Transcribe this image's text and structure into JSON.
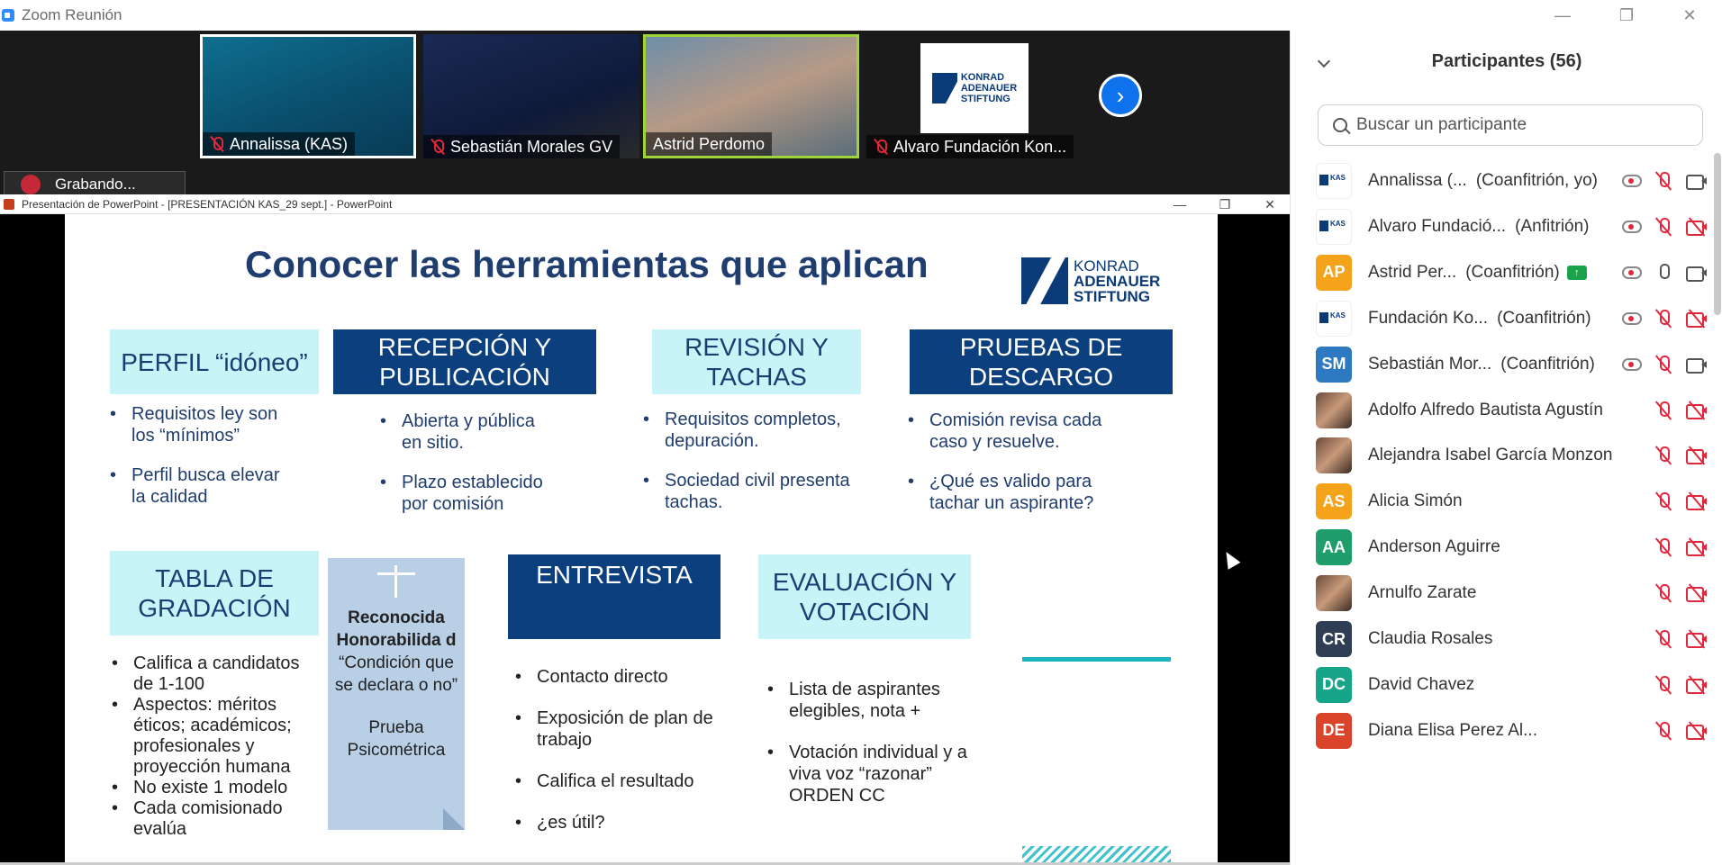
{
  "window": {
    "title": "Zoom Reunión"
  },
  "videos": [
    {
      "name": "Annalissa (KAS)",
      "muted": true
    },
    {
      "name": "Sebastián Morales GV",
      "muted": true
    },
    {
      "name": "Astrid Perdomo",
      "muted": false
    },
    {
      "name": "Alvaro Fundación Kon...",
      "muted": true
    }
  ],
  "recording": {
    "label": "Grabando..."
  },
  "ppt": {
    "title": "Presentación de PowerPoint - [PRESENTACIÓN KAS_29 sept.] - PowerPoint"
  },
  "slide": {
    "title": "Conocer las herramientas que aplican",
    "logo": {
      "line1": "KONRAD",
      "line2": "ADENAUER",
      "line3": "STIFTUNG"
    },
    "boxes": {
      "perfil": "PERFIL “idóneo”",
      "recepcion": "RECEPCIÓN Y PUBLICACIÓN",
      "revision": "REVISIÓN Y TACHAS",
      "pruebas": "PRUEBAS DE DESCARGO",
      "tabla": "TABLA DE GRADACIÓN",
      "entrevista": "ENTREVISTA",
      "evaluacion": "EVALUACIÓN Y VOTACIÓN"
    },
    "bullets": {
      "perfil": [
        "Requisitos ley son los “mínimos”",
        "Perfil busca elevar la calidad"
      ],
      "recepcion": [
        "Abierta y pública en sitio.",
        "Plazo establecido por comisión"
      ],
      "revision": [
        "Requisitos completos, depuración.",
        "Sociedad civil presenta tachas."
      ],
      "pruebas": [
        "Comisión revisa cada caso y resuelve.",
        "¿Qué es valido para tachar un aspirante?"
      ],
      "tabla": [
        "Califica a candidatos de 1-100",
        "Aspectos: méritos éticos;  académicos; profesionales y proyección humana",
        "No existe 1 modelo",
        "Cada comisionado evalúa"
      ],
      "entrevista": [
        "Contacto directo",
        "Exposición de plan de trabajo",
        "Califica el resultado",
        "¿es útil?"
      ],
      "evaluacion": [
        "Lista de aspirantes elegibles, nota +",
        "Votación individual y a viva voz “razonar” ORDEN CC"
      ]
    },
    "card": {
      "bold": "Reconocida Honorabilida d",
      "quote": "“Condición que se declara o no”",
      "footer": "Prueba Psicométrica"
    }
  },
  "panel": {
    "title": "Participantes (56)",
    "search_placeholder": "Buscar un participante",
    "participants": [
      {
        "name": "Annalissa (...",
        "role": "(Coanfitrión, yo)",
        "avatar": "logo",
        "initials": "",
        "color": "",
        "rec": true,
        "mic": "off",
        "cam": "on"
      },
      {
        "name": "Alvaro Fundació...",
        "role": "(Anfitrión)",
        "avatar": "logo",
        "initials": "",
        "color": "",
        "rec": true,
        "mic": "off",
        "cam": "off"
      },
      {
        "name": "Astrid Per...",
        "role": "(Coanfitrión)",
        "avatar": "initials",
        "initials": "AP",
        "color": "#f5a31a",
        "rec": true,
        "mic": "on",
        "cam": "on",
        "badge": true
      },
      {
        "name": "Fundación Ko...",
        "role": "(Coanfitrión)",
        "avatar": "logo",
        "initials": "",
        "color": "",
        "rec": true,
        "mic": "off",
        "cam": "off"
      },
      {
        "name": "Sebastián Mor...",
        "role": "(Coanfitrión)",
        "avatar": "initials",
        "initials": "SM",
        "color": "#2d7ac2",
        "rec": true,
        "mic": "off",
        "cam": "on"
      },
      {
        "name": "Adolfo Alfredo Bautista Agustín",
        "role": "",
        "avatar": "photo",
        "initials": "",
        "color": "",
        "rec": false,
        "mic": "off",
        "cam": "off"
      },
      {
        "name": "Alejandra Isabel García Monzon",
        "role": "",
        "avatar": "photo",
        "initials": "",
        "color": "",
        "rec": false,
        "mic": "off",
        "cam": "off"
      },
      {
        "name": "Alicia Simón",
        "role": "",
        "avatar": "initials",
        "initials": "AS",
        "color": "#f5a31a",
        "rec": false,
        "mic": "off",
        "cam": "off"
      },
      {
        "name": "Anderson Aguirre",
        "role": "",
        "avatar": "initials",
        "initials": "AA",
        "color": "#1e9e6b",
        "rec": false,
        "mic": "off",
        "cam": "off"
      },
      {
        "name": "Arnulfo Zarate",
        "role": "",
        "avatar": "photo",
        "initials": "",
        "color": "",
        "rec": false,
        "mic": "off",
        "cam": "off"
      },
      {
        "name": "Claudia Rosales",
        "role": "",
        "avatar": "initials",
        "initials": "CR",
        "color": "#2f3e55",
        "rec": false,
        "mic": "off",
        "cam": "off"
      },
      {
        "name": "David Chavez",
        "role": "",
        "avatar": "initials",
        "initials": "DC",
        "color": "#17a589",
        "rec": false,
        "mic": "off",
        "cam": "off"
      },
      {
        "name": "Diana Elisa Perez Al...",
        "role": "",
        "avatar": "initials",
        "initials": "DE",
        "color": "#d9442b",
        "rec": false,
        "mic": "off",
        "cam": "off"
      }
    ]
  }
}
